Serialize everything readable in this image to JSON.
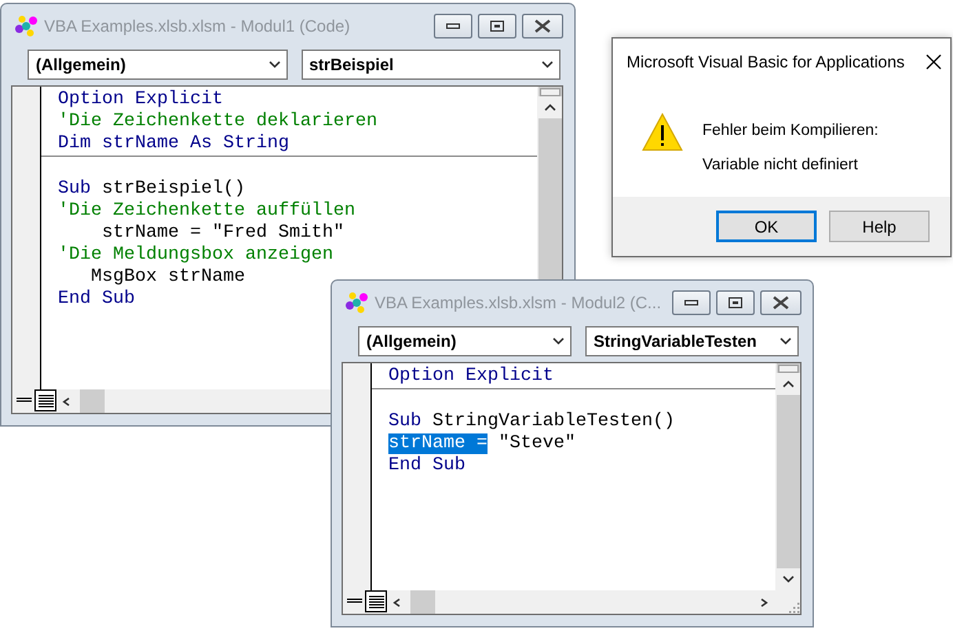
{
  "code_windows": [
    {
      "title": "VBA Examples.xlsb.xlsm - Modul1 (Code)",
      "active": false,
      "object_dropdown": "(Allgemein)",
      "procedure_dropdown": "strBeispiel",
      "sections": [
        [
          {
            "segments": [
              {
                "text": "Option Explicit",
                "kind": "keyword"
              }
            ]
          },
          {
            "segments": [
              {
                "text": "'Die Zeichenkette deklarieren",
                "kind": "comment"
              }
            ]
          },
          {
            "segments": [
              {
                "text": "Dim strName As String",
                "kind": "keyword"
              }
            ]
          }
        ],
        [
          {
            "segments": [
              {
                "text": "Sub",
                "kind": "keyword"
              },
              {
                "text": " strBeispiel()",
                "kind": "plain"
              }
            ]
          },
          {
            "segments": [
              {
                "text": "'Die Zeichenkette auffüllen",
                "kind": "comment"
              }
            ]
          },
          {
            "segments": [
              {
                "text": "    strName = \"Fred Smith\"",
                "kind": "plain"
              }
            ]
          },
          {
            "segments": [
              {
                "text": "'Die Meldungsbox anzeigen",
                "kind": "comment"
              }
            ]
          },
          {
            "segments": [
              {
                "text": "   MsgBox strName",
                "kind": "plain"
              }
            ]
          },
          {
            "segments": [
              {
                "text": "End Sub",
                "kind": "keyword"
              }
            ]
          }
        ]
      ]
    },
    {
      "title": "VBA Examples.xlsb.xlsm - Modul2 (C...",
      "active": false,
      "object_dropdown": "(Allgemein)",
      "procedure_dropdown": "StringVariableTesten",
      "sections": [
        [
          {
            "segments": [
              {
                "text": "Option Explicit",
                "kind": "keyword"
              }
            ]
          }
        ],
        [
          {
            "segments": [
              {
                "text": "Sub",
                "kind": "keyword"
              },
              {
                "text": " StringVariableTesten()",
                "kind": "plain"
              }
            ]
          },
          {
            "segments": [
              {
                "text": "strName =",
                "kind": "selected"
              },
              {
                "text": " \"Steve\"",
                "kind": "plain"
              }
            ]
          },
          {
            "segments": [
              {
                "text": "End Sub",
                "kind": "keyword"
              }
            ]
          }
        ]
      ]
    }
  ],
  "dialog": {
    "title": "Microsoft Visual Basic for Applications",
    "active": true,
    "heading": "Fehler beim Kompilieren:",
    "message": "Variable nicht definiert",
    "buttons": [
      {
        "label": "OK",
        "focused": true
      },
      {
        "label": "Help",
        "focused": false
      }
    ]
  }
}
